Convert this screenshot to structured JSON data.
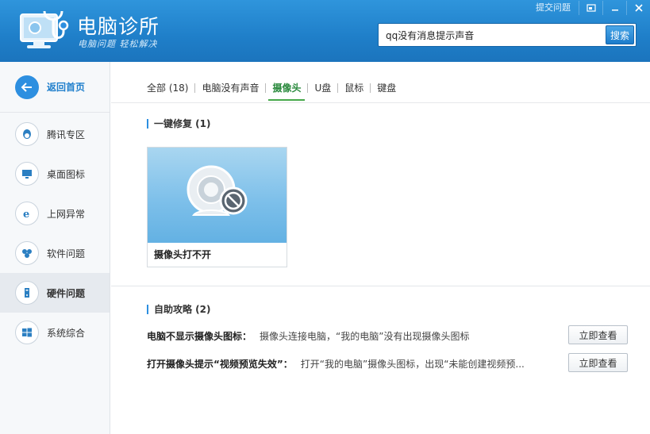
{
  "header": {
    "app_title": "电脑诊所",
    "app_slogan": "电脑问题 轻松解决",
    "feedback_link": "提交问题",
    "search": {
      "value": "qq没有消息提示声音",
      "button_label": "搜索"
    }
  },
  "sidebar": {
    "home_label": "返回首页",
    "items": [
      {
        "label": "腾讯专区",
        "icon": "qq-penguin-icon"
      },
      {
        "label": "桌面图标",
        "icon": "monitor-icon"
      },
      {
        "label": "上网异常",
        "icon": "ie-browser-icon"
      },
      {
        "label": "软件问题",
        "icon": "software-icon"
      },
      {
        "label": "硬件问题",
        "icon": "hardware-icon",
        "active": true
      },
      {
        "label": "系统综合",
        "icon": "windows-icon"
      }
    ]
  },
  "tabs": [
    {
      "label": "全部 (18)"
    },
    {
      "label": "电脑没有声音"
    },
    {
      "label": "摄像头",
      "active": true
    },
    {
      "label": "U盘"
    },
    {
      "label": "鼠标"
    },
    {
      "label": "键盘"
    }
  ],
  "repair": {
    "title": "一键修复 (1)",
    "card_label": "摄像头打不开"
  },
  "guides": {
    "title": "自助攻略 (2)",
    "items": [
      {
        "title": "电脑不显示摄像头图标：",
        "desc": "摄像头连接电脑，“我的电脑”没有出现摄像头图标",
        "button": "立即查看"
      },
      {
        "title": "打开摄像头提示“视频预览失效”：",
        "desc": "打开“我的电脑”摄像头图标，出现“未能创建视频预...",
        "button": "立即查看"
      }
    ]
  },
  "colors": {
    "brand": "#1f7fc9",
    "accent_green": "#46a84a",
    "section_bar": "#2d8fe0"
  }
}
